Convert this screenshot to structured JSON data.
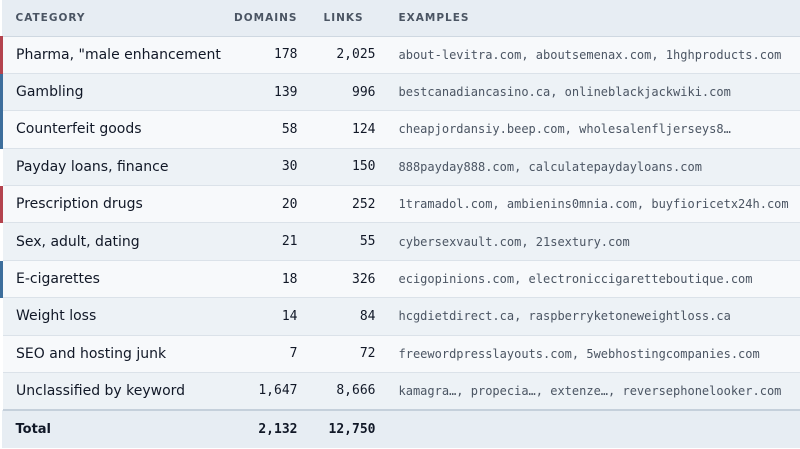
{
  "headers": {
    "category": "CATEGORY",
    "domains": "DOMAINS",
    "links": "LINKS",
    "examples": "EXAMPLES"
  },
  "accent_colors": {
    "red": "#b4434e",
    "blue": "#3d6e9c"
  },
  "rows": [
    {
      "category": "Pharma, \"male enhancement\"",
      "domains": "178",
      "links": "2,025",
      "examples": "about-levitra.com, aboutsemenax.com, 1hghproducts.com",
      "accent": "red"
    },
    {
      "category": "Gambling",
      "domains": "139",
      "links": "996",
      "examples": "bestcanadiancasino.ca, onlineblackjackwiki.com",
      "accent": "blue"
    },
    {
      "category": "Counterfeit goods",
      "domains": "58",
      "links": "124",
      "examples": "cheapjordansiy.beep.com, wholesalenfljerseys8…",
      "accent": "blue"
    },
    {
      "category": "Payday loans, finance",
      "domains": "30",
      "links": "150",
      "examples": "888payday888.com, calculatepaydayloans.com",
      "accent": "none"
    },
    {
      "category": "Prescription drugs",
      "domains": "20",
      "links": "252",
      "examples": "1tramadol.com, ambienins0mnia.com, buyfioricetx24h.com",
      "accent": "red"
    },
    {
      "category": "Sex, adult, dating",
      "domains": "21",
      "links": "55",
      "examples": "cybersexvault.com, 21sextury.com",
      "accent": "none"
    },
    {
      "category": "E-cigarettes",
      "domains": "18",
      "links": "326",
      "examples": "ecigopinions.com, electroniccigaretteboutique.com",
      "accent": "blue"
    },
    {
      "category": "Weight loss",
      "domains": "14",
      "links": "84",
      "examples": "hcgdietdirect.ca, raspberryketoneweightloss.ca",
      "accent": "none"
    },
    {
      "category": "SEO and hosting junk",
      "domains": "7",
      "links": "72",
      "examples": "freewordpresslayouts.com, 5webhostingcompanies.com",
      "accent": "none"
    },
    {
      "category": "Unclassified by keyword",
      "domains": "1,647",
      "links": "8,666",
      "examples": "kamagra…, propecia…, extenze…, reversephonelooker.com",
      "accent": "none"
    }
  ],
  "total": {
    "label": "Total",
    "domains": "2,132",
    "links": "12,750"
  }
}
